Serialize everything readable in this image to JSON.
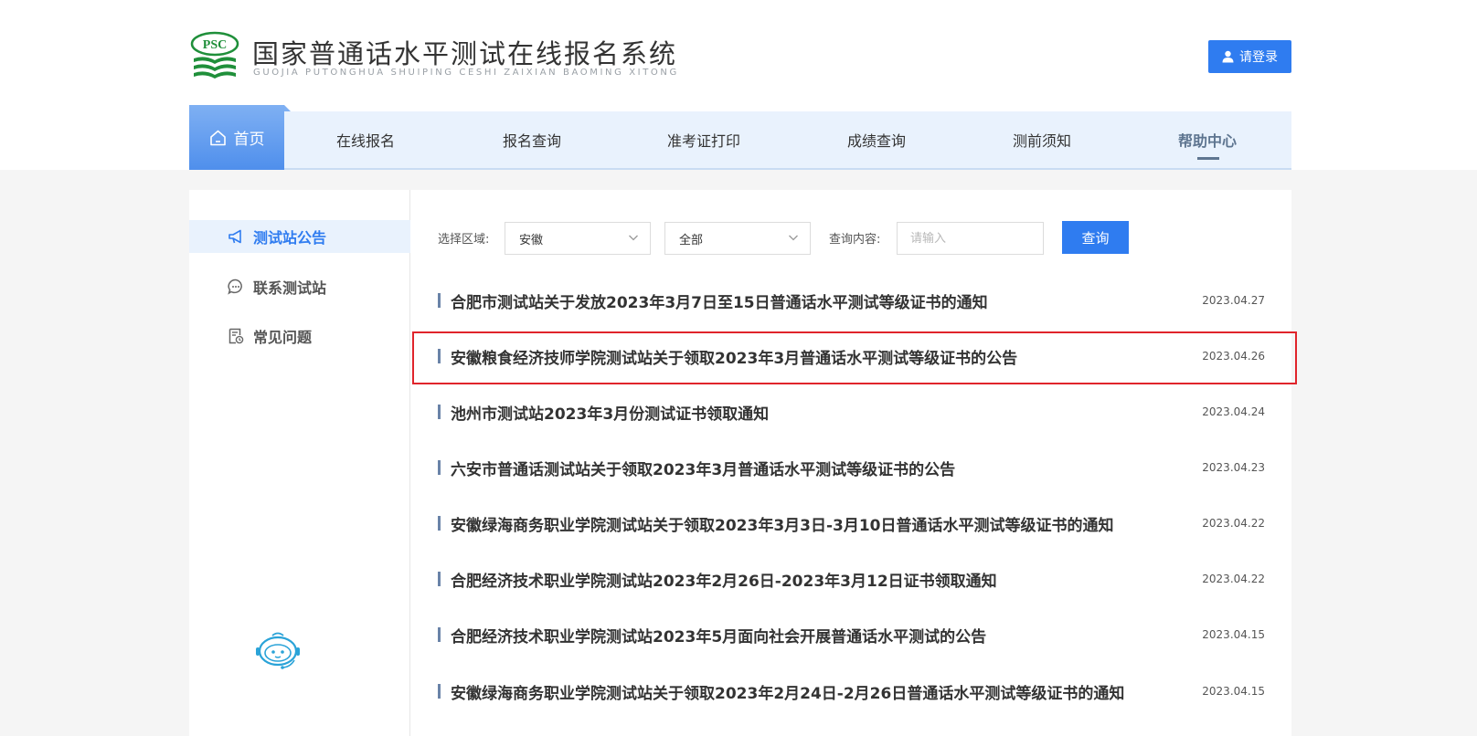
{
  "header": {
    "logo_text": "PSC",
    "title": "国家普通话水平测试在线报名系统",
    "subtitle": "GUOJIA PUTONGHUA SHUIPING CESHI ZAIXIAN BAOMING XITONG",
    "login_label": "请登录"
  },
  "nav": {
    "items": [
      {
        "label": "首页",
        "active": true
      },
      {
        "label": "在线报名"
      },
      {
        "label": "报名查询"
      },
      {
        "label": "准考证打印"
      },
      {
        "label": "成绩查询"
      },
      {
        "label": "测前须知"
      },
      {
        "label": "帮助中心",
        "current": true
      }
    ]
  },
  "sidebar": {
    "items": [
      {
        "label": "测试站公告",
        "icon": "megaphone-icon",
        "active": true
      },
      {
        "label": "联系测试站",
        "icon": "chat-bubble-icon"
      },
      {
        "label": "常见问题",
        "icon": "document-clock-icon"
      }
    ],
    "assistant_icon": "robot-assistant-icon"
  },
  "filters": {
    "region_label": "选择区域:",
    "region_value": "安徽",
    "scope_value": "全部",
    "query_label": "查询内容:",
    "query_placeholder": "请输入",
    "query_button": "查询"
  },
  "notices": [
    {
      "title": "合肥市测试站关于发放2023年3月7日至15日普通话水平测试等级证书的通知",
      "date": "2023.04.27"
    },
    {
      "title": "安徽粮食经济技师学院测试站关于领取2023年3月普通话水平测试等级证书的公告",
      "date": "2023.04.26",
      "highlighted": true
    },
    {
      "title": "池州市测试站2023年3月份测试证书领取通知",
      "date": "2023.04.24"
    },
    {
      "title": "六安市普通话测试站关于领取2023年3月普通话水平测试等级证书的公告",
      "date": "2023.04.23"
    },
    {
      "title": "安徽绿海商务职业学院测试站关于领取2023年3月3日-3月10日普通话水平测试等级证书的通知",
      "date": "2023.04.22"
    },
    {
      "title": "合肥经济技术职业学院测试站2023年2月26日-2023年3月12日证书领取通知",
      "date": "2023.04.22"
    },
    {
      "title": "合肥经济技术职业学院测试站2023年5月面向社会开展普通话水平测试的公告",
      "date": "2023.04.15"
    },
    {
      "title": "安徽绿海商务职业学院测试站关于领取2023年2月24日-2月26日普通话水平测试等级证书的通知",
      "date": "2023.04.15"
    }
  ],
  "colors": {
    "accent": "#2f7cf0",
    "highlight_border": "#e0242b",
    "logo_green": "#1f8f3a"
  }
}
